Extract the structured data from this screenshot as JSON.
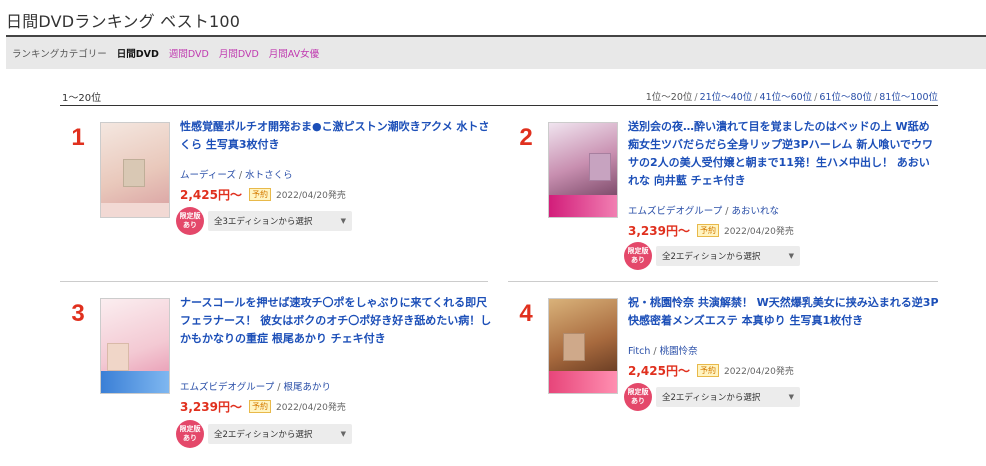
{
  "header": {
    "title": "日間DVDランキング ベスト100"
  },
  "category_bar": {
    "label": "ランキングカテゴリー",
    "items": [
      {
        "label": "日間DVD",
        "active": true
      },
      {
        "label": "週間DVD",
        "active": false
      },
      {
        "label": "月間DVD",
        "active": false
      },
      {
        "label": "月間AV女優",
        "active": false
      }
    ]
  },
  "list_header": {
    "range": "1〜20位",
    "pager": [
      "1位〜20位",
      "21位〜40位",
      "41位〜60位",
      "61位〜80位",
      "81位〜100位"
    ]
  },
  "items": [
    {
      "rank": "1",
      "title": "性感覚醒ポルチオ開発おま●こ激ピストン潮吹きアクメ 水トさくら 生写真3枚付き",
      "maker": "ムーディーズ",
      "actress": "水トさくら",
      "price": "2,425円〜",
      "badge": "予約",
      "release": "2022/04/20発売",
      "limited": "限定版\nあり",
      "edition": "全3エディションから選択"
    },
    {
      "rank": "2",
      "title": "送別会の夜…酔い潰れて目を覚ましたのはベッドの上 W舐め痴女生ツバだらだら全身リップ逆3Pハーレム 新人喰いでウワサの2人の美人受付嬢と朝まで11発！生ハメ中出し！ あおいれな 向井藍 チェキ付き",
      "maker": "エムズビデオグループ",
      "actress": "あおいれな",
      "price": "3,239円〜",
      "badge": "予約",
      "release": "2022/04/20発売",
      "limited": "限定版\nあり",
      "edition": "全2エディションから選択"
    },
    {
      "rank": "3",
      "title": "ナースコールを押せば速攻チ〇ポをしゃぶりに来てくれる即尺フェラナース！ 彼女はボクのオチ〇ポ好き好き舐めたい病！しかもかなりの重症 根尾あかり チェキ付き",
      "maker": "エムズビデオグループ",
      "actress": "根尾あかり",
      "price": "3,239円〜",
      "badge": "予約",
      "release": "2022/04/20発売",
      "limited": "限定版\nあり",
      "edition": "全2エディションから選択"
    },
    {
      "rank": "4",
      "title": "祝・桃園怜奈 共演解禁！ W天然爆乳美女に挟み込まれる逆3P快感密着メンズエステ 本真ゆり 生写真1枚付き",
      "maker": "Fitch",
      "actress": "桃園怜奈",
      "price": "2,425円〜",
      "badge": "予約",
      "release": "2022/04/20発売",
      "limited": "限定版\nあり",
      "edition": "全2エディションから選択"
    }
  ],
  "colors": {
    "rank": "#e0301e",
    "link": "#1c4fb8",
    "category": "#c03ab0",
    "limited": "#e4486a"
  }
}
